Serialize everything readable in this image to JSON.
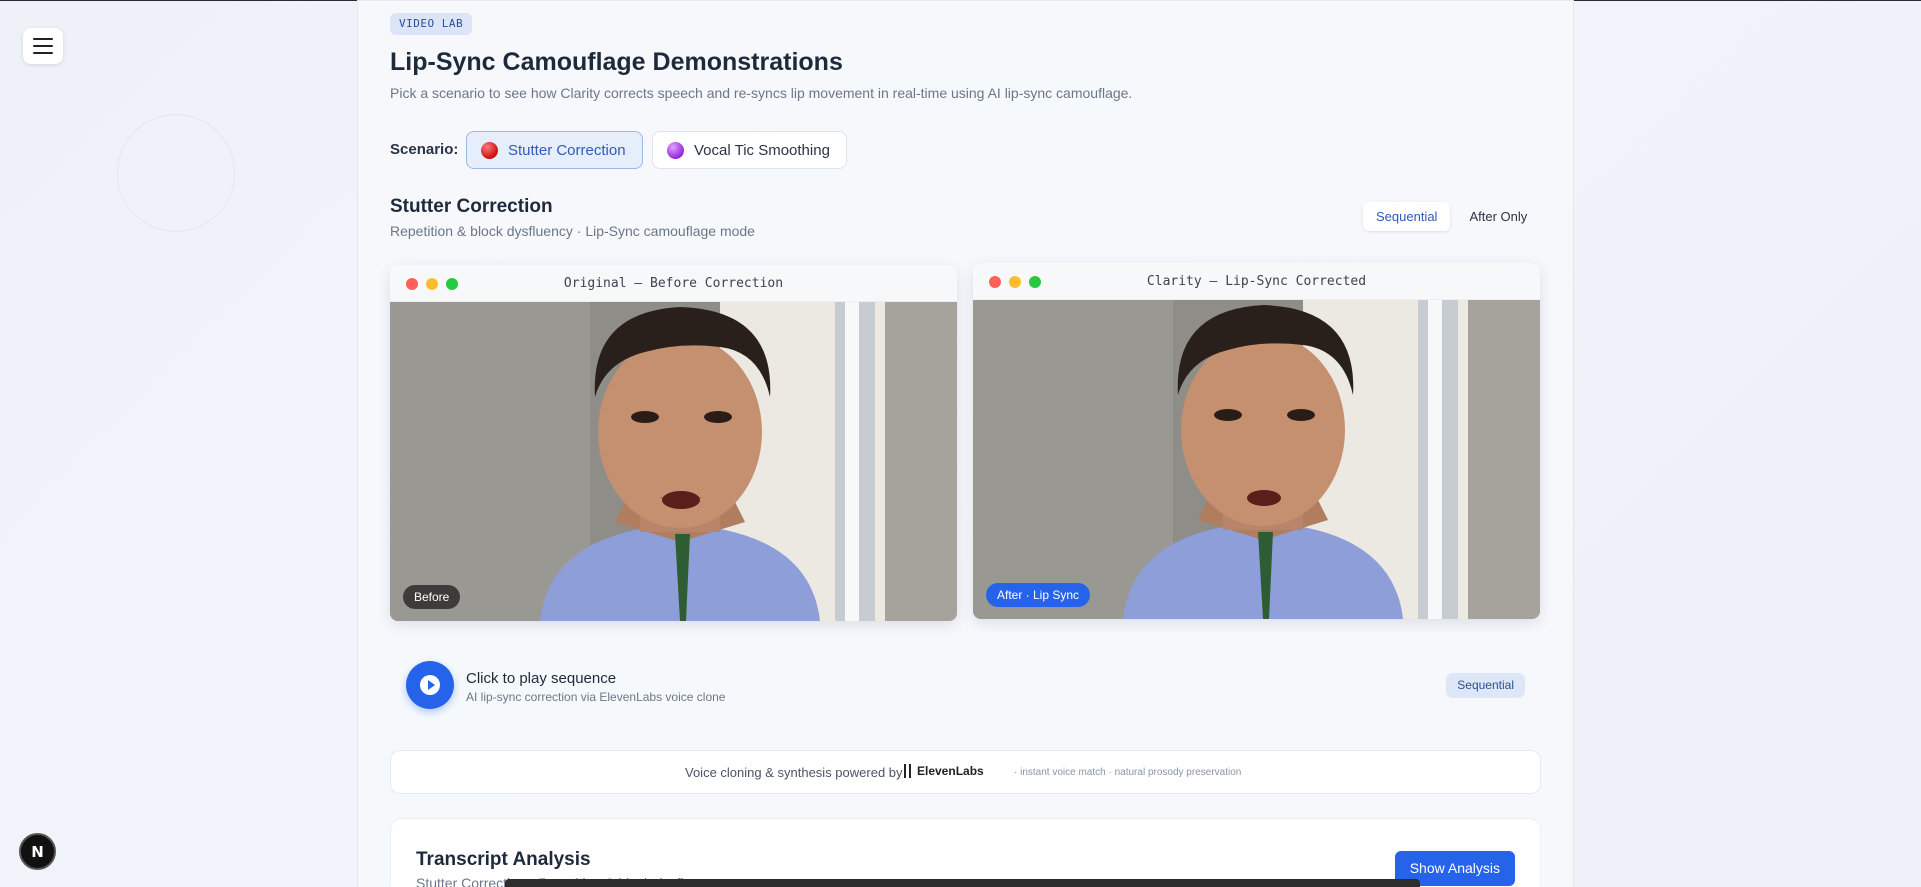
{
  "sidebar": {
    "menu_icon": "hamburger-icon"
  },
  "header": {
    "eyebrow": "VIDEO LAB",
    "title": "Lip-Sync Camouflage Demonstrations",
    "subtitle": "Pick a scenario to see how Clarity corrects speech and re-syncs lip movement in real-time using AI lip-sync camouflage."
  },
  "scenario": {
    "label": "Scenario:",
    "options": [
      {
        "label": "Stutter Correction",
        "icon": "red-circle-icon",
        "active": true
      },
      {
        "label": "Vocal Tic Smoothing",
        "icon": "purple-circle-icon",
        "active": false
      }
    ]
  },
  "section": {
    "title": "Stutter Correction",
    "subtitle": "Repetition & block dysfluency · Lip-Sync camouflage mode",
    "modes": [
      "Sequential",
      "After Only"
    ],
    "active_mode": "Sequential"
  },
  "videos": {
    "before": {
      "title": "Original — Before Correction",
      "tag": "Before"
    },
    "after": {
      "title": "Clarity — Lip-Sync Corrected",
      "tag": "After · Lip Sync"
    }
  },
  "player": {
    "title": "Click to play sequence",
    "subtitle": "AI lip-sync correction via ElevenLabs voice clone",
    "mode_pill": "Sequential"
  },
  "credit": {
    "text": "Voice cloning & synthesis powered by",
    "brand": "ElevenLabs",
    "note": "· instant voice match · natural prosody preservation"
  },
  "transcript": {
    "title": "Transcript Analysis",
    "subtitle": "Stutter Correction · Repetition & block dysfluency",
    "button": "Show Analysis"
  },
  "dev_badge": "N",
  "colors": {
    "accent": "#2563eb",
    "active_bg": "#e6eefb"
  }
}
